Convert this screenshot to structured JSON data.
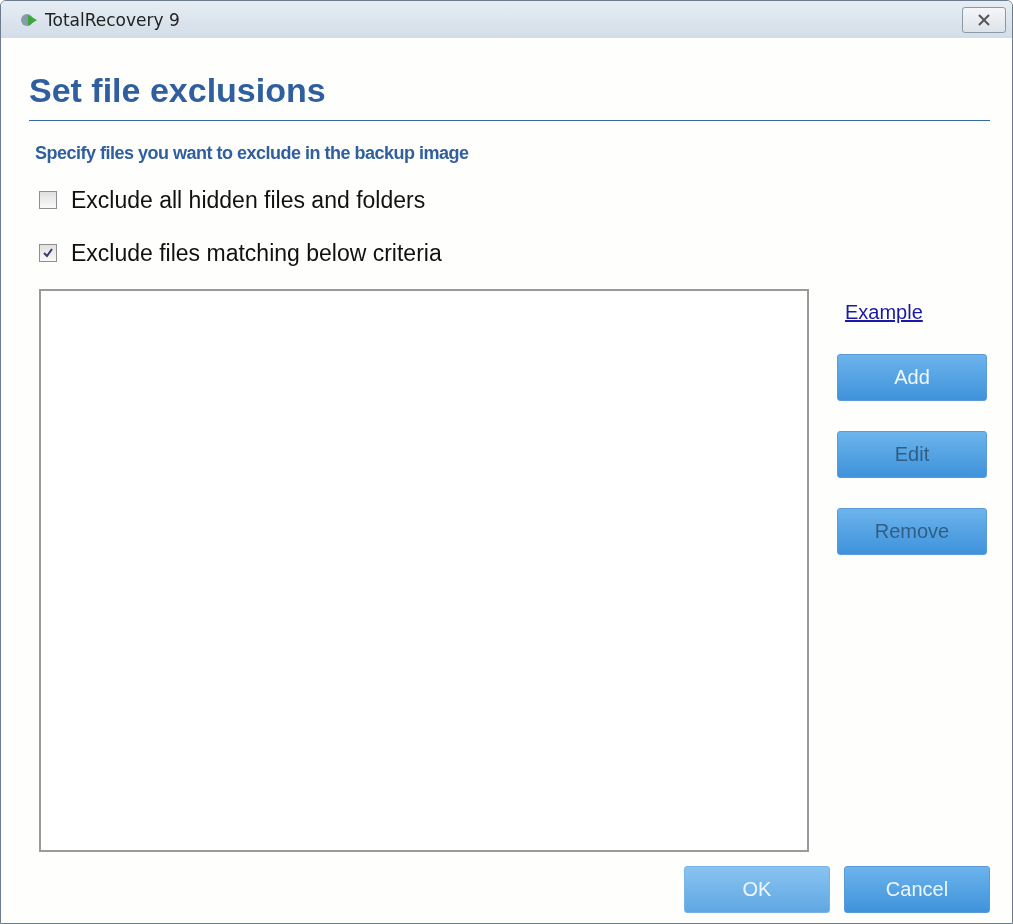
{
  "window": {
    "title": "TotalRecovery 9"
  },
  "heading": "Set file exclusions",
  "subtitle": "Specify files you want to exclude in the backup image",
  "options": [
    {
      "label": "Exclude all hidden files and folders",
      "checked": false
    },
    {
      "label": "Exclude files matching below criteria",
      "checked": true
    }
  ],
  "example_link": "Example",
  "side_buttons": [
    {
      "label": "Add",
      "disabled": false
    },
    {
      "label": "Edit",
      "disabled": true
    },
    {
      "label": "Remove",
      "disabled": true
    }
  ],
  "footer_buttons": [
    "OK",
    "Cancel"
  ]
}
